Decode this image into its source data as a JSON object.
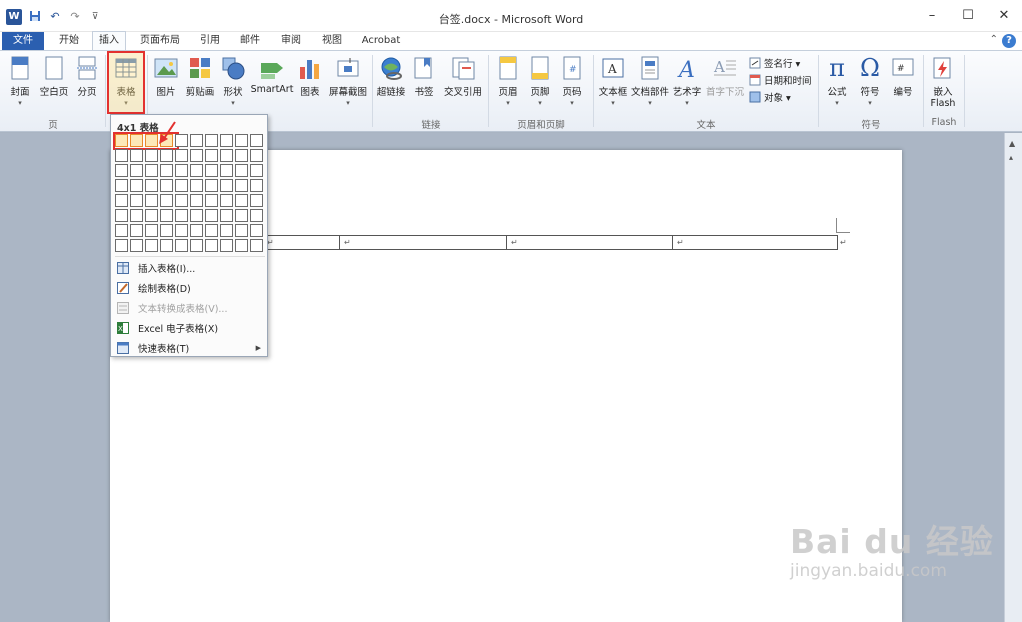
{
  "titlebar": {
    "app_title": "台签.docx - Microsoft Word",
    "logo": "W",
    "window_controls": [
      "–",
      "☐",
      "✕"
    ]
  },
  "tabs": [
    {
      "label": "文件"
    },
    {
      "label": "开始"
    },
    {
      "label": "插入"
    },
    {
      "label": "页面布局"
    },
    {
      "label": "引用"
    },
    {
      "label": "邮件"
    },
    {
      "label": "审阅"
    },
    {
      "label": "视图"
    },
    {
      "label": "Acrobat"
    }
  ],
  "active_tab": "插入",
  "ribbon": {
    "buttons": [
      {
        "label": "封面"
      },
      {
        "label": "空白页"
      },
      {
        "label": "分页"
      },
      {
        "label": "表格"
      },
      {
        "label": "图片"
      },
      {
        "label": "剪贴画"
      },
      {
        "label": "形状"
      },
      {
        "label": "SmartArt"
      },
      {
        "label": "图表"
      },
      {
        "label": "屏幕截图"
      },
      {
        "label": "超链接"
      },
      {
        "label": "书签"
      },
      {
        "label": "交叉引用"
      },
      {
        "label": "页眉"
      },
      {
        "label": "页脚"
      },
      {
        "label": "页码"
      },
      {
        "label": "文本框"
      },
      {
        "label": "文档部件"
      },
      {
        "label": "艺术字"
      },
      {
        "label": "首字下沉"
      },
      {
        "label": "公式"
      },
      {
        "label": "符号"
      },
      {
        "label": "编号"
      },
      {
        "label": "嵌入"
      },
      {
        "label": "Flash"
      }
    ],
    "small_items": [
      {
        "label": "签名行 ▾"
      },
      {
        "label": "日期和时间"
      },
      {
        "label": "对象 ▾"
      }
    ],
    "groups": [
      {
        "label": "页"
      },
      {
        "label": "链接"
      },
      {
        "label": "页眉和页脚"
      },
      {
        "label": "文本"
      },
      {
        "label": "符号"
      },
      {
        "label": "Flash"
      }
    ]
  },
  "table_dropdown": {
    "header": "4x1 表格",
    "grid": {
      "cols": 10,
      "rows": 8,
      "selected_cols": 4,
      "selected_rows": 1
    },
    "items": [
      {
        "label": "插入表格(I)...",
        "enabled": true,
        "submenu": false
      },
      {
        "label": "绘制表格(D)",
        "enabled": true,
        "submenu": false
      },
      {
        "label": "文本转换成表格(V)...",
        "enabled": false,
        "submenu": false
      },
      {
        "label": "Excel 电子表格(X)",
        "enabled": true,
        "submenu": false
      },
      {
        "label": "快速表格(T)",
        "enabled": true,
        "submenu": true
      }
    ]
  },
  "document": {
    "table_cells": [
      "↵",
      "↵",
      "↵",
      "↵"
    ],
    "para_mark": "↵"
  },
  "watermark": {
    "line1": "Bai du 经验",
    "line2": "jingyan.baidu.com"
  },
  "colors": {
    "file_tab": "#2b5fb0",
    "highlight": "#e3312f",
    "grid_hover": "#fde9b8"
  }
}
